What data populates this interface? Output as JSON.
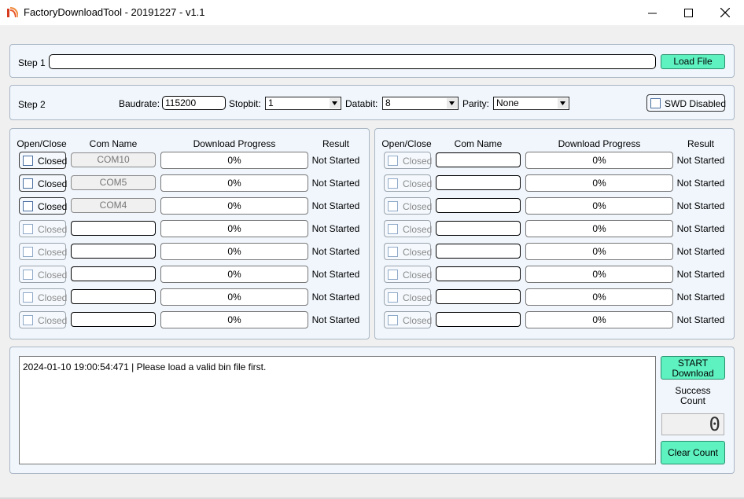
{
  "window": {
    "title": "FactoryDownloadTool - 20191227 - v1.1",
    "icon": "app-logo-icon"
  },
  "step1": {
    "label": "Step 1",
    "file_path": "",
    "load_button": "Load File"
  },
  "step2": {
    "label": "Step 2",
    "baudrate_label": "Baudrate:",
    "baudrate_value": "115200",
    "stopbit_label": "Stopbit:",
    "stopbit_value": "1",
    "databit_label": "Databit:",
    "databit_value": "8",
    "parity_label": "Parity:",
    "parity_value": "None",
    "swd_label": "SWD Disabled"
  },
  "table_headers": {
    "open_close": "Open/Close",
    "com_name": "Com Name",
    "progress": "Download Progress",
    "result": "Result"
  },
  "left_ports": [
    {
      "state": "Closed",
      "com": "COM10",
      "progress": "0%",
      "result": "Not Started",
      "enabled": true
    },
    {
      "state": "Closed",
      "com": "COM5",
      "progress": "0%",
      "result": "Not Started",
      "enabled": true
    },
    {
      "state": "Closed",
      "com": "COM4",
      "progress": "0%",
      "result": "Not Started",
      "enabled": true
    },
    {
      "state": "Closed",
      "com": "",
      "progress": "0%",
      "result": "Not Started",
      "enabled": false
    },
    {
      "state": "Closed",
      "com": "",
      "progress": "0%",
      "result": "Not Started",
      "enabled": false
    },
    {
      "state": "Closed",
      "com": "",
      "progress": "0%",
      "result": "Not Started",
      "enabled": false
    },
    {
      "state": "Closed",
      "com": "",
      "progress": "0%",
      "result": "Not Started",
      "enabled": false
    },
    {
      "state": "Closed",
      "com": "",
      "progress": "0%",
      "result": "Not Started",
      "enabled": false
    }
  ],
  "right_ports": [
    {
      "state": "Closed",
      "com": "",
      "progress": "0%",
      "result": "Not Started",
      "enabled": false
    },
    {
      "state": "Closed",
      "com": "",
      "progress": "0%",
      "result": "Not Started",
      "enabled": false
    },
    {
      "state": "Closed",
      "com": "",
      "progress": "0%",
      "result": "Not Started",
      "enabled": false
    },
    {
      "state": "Closed",
      "com": "",
      "progress": "0%",
      "result": "Not Started",
      "enabled": false
    },
    {
      "state": "Closed",
      "com": "",
      "progress": "0%",
      "result": "Not Started",
      "enabled": false
    },
    {
      "state": "Closed",
      "com": "",
      "progress": "0%",
      "result": "Not Started",
      "enabled": false
    },
    {
      "state": "Closed",
      "com": "",
      "progress": "0%",
      "result": "Not Started",
      "enabled": false
    },
    {
      "state": "Closed",
      "com": "",
      "progress": "0%",
      "result": "Not Started",
      "enabled": false
    }
  ],
  "log": {
    "text": "2024-01-10 19:00:54:471 | Please load a valid bin file first."
  },
  "actions": {
    "start_line1": "START",
    "start_line2": "Download",
    "success_line1": "Success",
    "success_line2": "Count",
    "success_count": "0",
    "clear_button": "Clear Count"
  },
  "colors": {
    "accent_button": "#5ef2c0",
    "panel_bg": "#f0f6fc"
  }
}
